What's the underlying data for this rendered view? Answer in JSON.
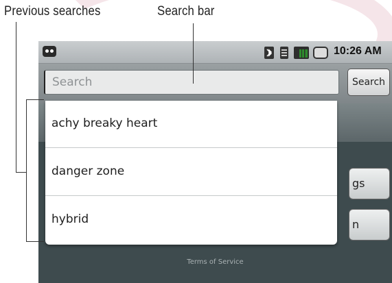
{
  "callouts": {
    "previous_searches": "Previous searches",
    "search_bar": "Search bar"
  },
  "statusbar": {
    "time": "10:26 AM",
    "icons": [
      "app-notification-icon",
      "bluetooth-icon",
      "wifi-icon",
      "signal-icon",
      "battery-icon"
    ]
  },
  "search": {
    "placeholder": "Search",
    "button_label": "Search"
  },
  "previous_searches": [
    "achy breaky heart",
    "danger zone",
    "hybrid"
  ],
  "background_buttons": [
    {
      "partial_label": "gs"
    },
    {
      "partial_label": "n"
    }
  ],
  "footer": {
    "terms": "Terms of Service"
  }
}
